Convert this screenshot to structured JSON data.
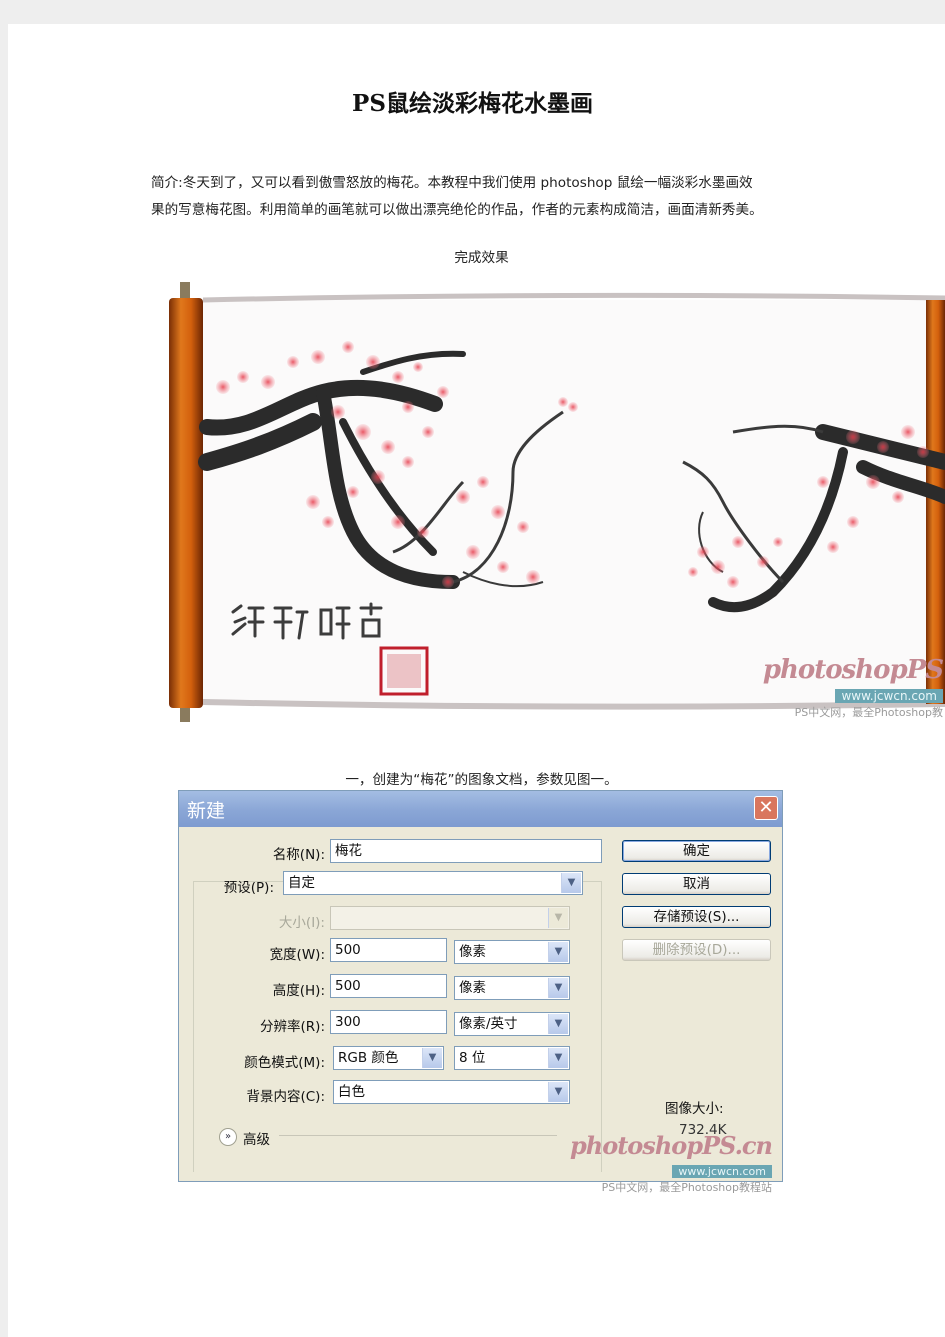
{
  "article": {
    "title": "PS鼠绘淡彩梅花水墨画",
    "intro_line1": "简介:冬天到了，又可以看到傲雪怒放的梅花。本教程中我们使用 photoshop 鼠绘一幅淡彩水墨画效",
    "intro_line2": "果的写意梅花图。利用简单的画笔就可以做出漂亮绝伦的作品，作者的元素构成简洁，画面清新秀美。",
    "caption_result": "完成效果",
    "caption_step1": "一，创建为“梅花”的图象文档，参数见图一。"
  },
  "painting": {
    "watermark_logo": "photoshopPS",
    "watermark_url": "www.jcwcn.com",
    "watermark_sub": "PS中文网，最全Photoshop教"
  },
  "dialog": {
    "title": "新建",
    "close_glyph": "✕",
    "name_label": "名称(N):",
    "name_value": "梅花",
    "preset_label": "预设(P):",
    "preset_value": "自定",
    "size_label": "大小(I):",
    "width_label": "宽度(W):",
    "width_value": "500",
    "width_unit": "像素",
    "height_label": "高度(H):",
    "height_value": "500",
    "height_unit": "像素",
    "resolution_label": "分辨率(R):",
    "resolution_value": "300",
    "resolution_unit": "像素/英寸",
    "color_mode_label": "颜色模式(M):",
    "color_mode_value": "RGB 颜色",
    "bit_depth_value": "8 位",
    "background_label": "背景内容(C):",
    "background_value": "白色",
    "advanced_label": "高级",
    "ok_button": "确定",
    "cancel_button": "取消",
    "save_preset_button": "存储预设(S)...",
    "delete_preset_button": "删除预设(D)...",
    "image_size_label": "图像大小:",
    "image_size_value": "732.4K",
    "watermark_logo": "photoshopPS.cn",
    "watermark_url": "www.jcwcn.com",
    "watermark_sub": "PS中文网，最全Photoshop教程站"
  }
}
